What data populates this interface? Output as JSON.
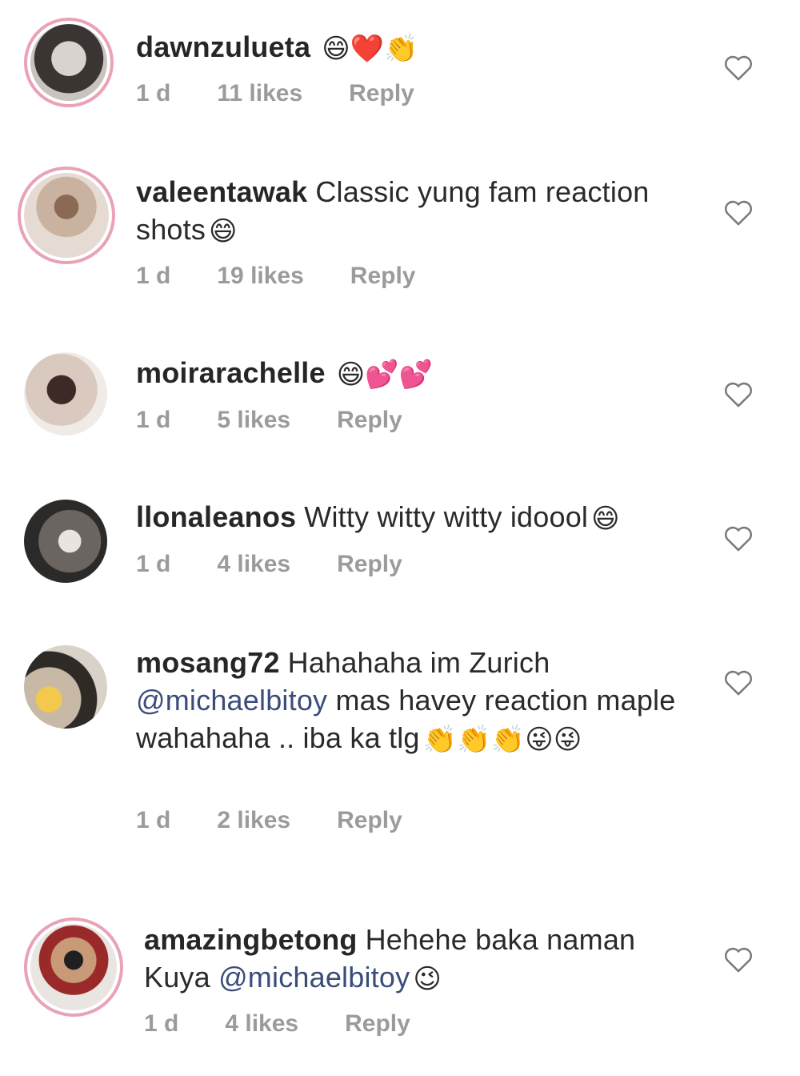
{
  "comments": [
    {
      "username": "dawnzulueta",
      "text": "",
      "emoji": "😄❤️👏",
      "time": "1 d",
      "likes": "11 likes",
      "reply": "Reply"
    },
    {
      "username": "valeentawak",
      "text": "Classic yung fam reaction shots",
      "emoji": "😄",
      "time": "1 d",
      "likes": "19 likes",
      "reply": "Reply"
    },
    {
      "username": "moirarachelle",
      "text": "",
      "emoji": "😄💕💕",
      "time": "1 d",
      "likes": "5 likes",
      "reply": "Reply"
    },
    {
      "username": "llonaleanos",
      "text": "Witty witty witty idoool",
      "emoji": "😄",
      "time": "1 d",
      "likes": "4 likes",
      "reply": "Reply"
    },
    {
      "username": "mosang72",
      "text_before": "Hahahaha im Zurich",
      "mention": "@michaelbitoy",
      "text_after": "mas havey reaction maple wahahaha .. iba ka tlg",
      "emoji": "👏👏👏😜😜",
      "time": "1 d",
      "likes": "2 likes",
      "reply": "Reply"
    },
    {
      "username": "amazingbetong",
      "text_before": "Hehehe baka naman Kuya",
      "mention": "@michaelbitoy",
      "emoji": "😉",
      "time": "1 d",
      "likes": "4 likes",
      "reply": "Reply"
    }
  ],
  "colors": {
    "avatar_ring": "#e9a2b8",
    "meta_text": "#9b9b9b",
    "mention": "#3a4d7a"
  },
  "icons": {
    "like": "heart-outline-icon"
  }
}
